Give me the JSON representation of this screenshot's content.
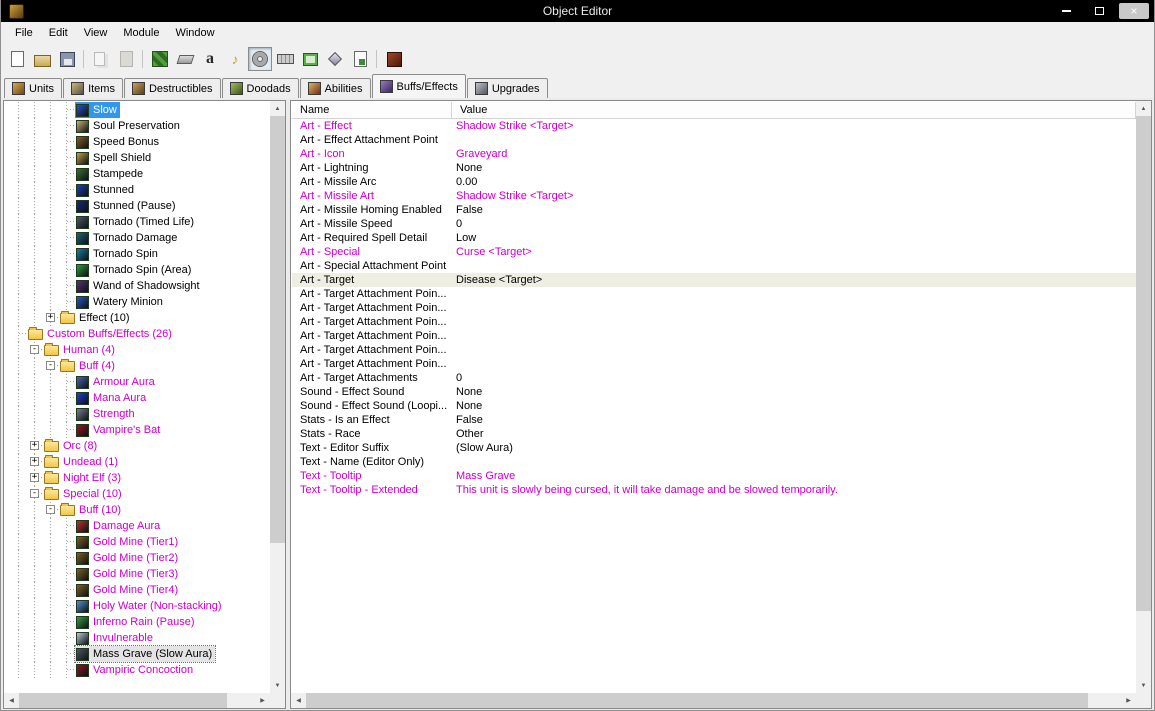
{
  "titlebar": {
    "title": "Object Editor"
  },
  "icons": {
    "close": "×",
    "scroll_up": "▲",
    "scroll_down": "▼",
    "scroll_left": "◀",
    "scroll_right": "▶",
    "expand": "+",
    "collapse": "-"
  },
  "colors": {
    "modified_text": "#c800c8",
    "selection_active": "#3296ef",
    "selection_inactive": "#e4e4e4",
    "titlebar_bg": "#000000"
  },
  "menubar": {
    "items": [
      "File",
      "Edit",
      "View",
      "Module",
      "Window"
    ]
  },
  "toolbar": {
    "buttons": [
      {
        "name": "new-map",
        "icon": "new-page"
      },
      {
        "name": "open-map",
        "icon": "open-folder"
      },
      {
        "name": "save-map",
        "icon": "save-floppy"
      },
      {
        "sep": true
      },
      {
        "name": "copy",
        "icon": "copy-pages",
        "disabled": true
      },
      {
        "name": "paste",
        "icon": "paste-clipboard",
        "disabled": true
      },
      {
        "sep": true
      },
      {
        "name": "terrain-editor",
        "icon": "terrain"
      },
      {
        "name": "eraser-tool",
        "icon": "eraser"
      },
      {
        "name": "trigger-editor",
        "icon": "letter-a",
        "glyph": "a"
      },
      {
        "name": "sound-editor",
        "icon": "speaker",
        "glyph": "♪"
      },
      {
        "name": "object-editor",
        "icon": "ring",
        "pressed": true
      },
      {
        "name": "campaign-editor",
        "icon": "keyboard"
      },
      {
        "name": "ai-editor",
        "icon": "ai-window"
      },
      {
        "name": "object-manager",
        "icon": "gem"
      },
      {
        "name": "import-manager",
        "icon": "import-page"
      },
      {
        "sep": true
      },
      {
        "name": "test-map",
        "icon": "test-map"
      }
    ]
  },
  "tabs": {
    "items": [
      {
        "label": "Units",
        "colors": [
          "#d8a850",
          "#6a4a18"
        ]
      },
      {
        "label": "Items",
        "colors": [
          "#c8b878",
          "#585048"
        ]
      },
      {
        "label": "Destructibles",
        "colors": [
          "#c8a060",
          "#584018"
        ]
      },
      {
        "label": "Doodads",
        "colors": [
          "#a8b860",
          "#3a5818"
        ]
      },
      {
        "label": "Abilities",
        "colors": [
          "#d8b860",
          "#7a2818"
        ]
      },
      {
        "label": "Buffs/Effects",
        "colors": [
          "#9878c8",
          "#382858"
        ],
        "active": true
      },
      {
        "label": "Upgrades",
        "colors": [
          "#c0c0c8",
          "#505860"
        ]
      }
    ]
  },
  "tree": {
    "items": [
      {
        "indent": 3,
        "label": "Slow",
        "icon": "#2a50c8",
        "custom": false,
        "selected": "active"
      },
      {
        "indent": 3,
        "label": "Soul Preservation",
        "icon": "#c8b070",
        "custom": false
      },
      {
        "indent": 3,
        "label": "Speed Bonus",
        "icon": "#8a5a28",
        "custom": false
      },
      {
        "indent": 3,
        "label": "Spell Shield",
        "icon": "#c0a040",
        "custom": false
      },
      {
        "indent": 3,
        "label": "Stampede",
        "icon": "#3a7030",
        "custom": false
      },
      {
        "indent": 3,
        "label": "Stunned",
        "icon": "#2040b0",
        "custom": false
      },
      {
        "indent": 3,
        "label": "Stunned (Pause)",
        "icon": "#182878",
        "custom": false
      },
      {
        "indent": 3,
        "label": "Tornado (Timed Life)",
        "icon": "#505868",
        "custom": false
      },
      {
        "indent": 3,
        "label": "Tornado Damage",
        "icon": "#186878",
        "custom": false
      },
      {
        "indent": 3,
        "label": "Tornado Spin",
        "icon": "#1880a8",
        "custom": false
      },
      {
        "indent": 3,
        "label": "Tornado Spin (Area)",
        "icon": "#28a038",
        "custom": false
      },
      {
        "indent": 3,
        "label": "Wand of Shadowsight",
        "icon": "#583078",
        "custom": false
      },
      {
        "indent": 3,
        "label": "Watery Minion",
        "icon": "#2858c8",
        "custom": false
      },
      {
        "indent": 2,
        "expander": "plus",
        "folder": true,
        "label": "Effect (10)",
        "custom": false
      },
      {
        "indent": 0,
        "folder": true,
        "label": "Custom Buffs/Effects (26)",
        "custom": true
      },
      {
        "indent": 1,
        "expander": "minus",
        "folder": true,
        "label": "Human (4)",
        "custom": true
      },
      {
        "indent": 2,
        "expander": "minus",
        "folder": true,
        "label": "Buff (4)",
        "custom": true
      },
      {
        "indent": 3,
        "label": "Armour Aura",
        "icon": "#4868b0",
        "custom": true
      },
      {
        "indent": 3,
        "label": "Mana Aura",
        "icon": "#2040d0",
        "custom": true
      },
      {
        "indent": 3,
        "label": "Strength",
        "icon": "#788090",
        "custom": true
      },
      {
        "indent": 3,
        "label": "Vampire's Bat",
        "icon": "#981820",
        "custom": true
      },
      {
        "indent": 1,
        "expander": "plus",
        "folder": true,
        "label": "Orc (8)",
        "custom": true
      },
      {
        "indent": 1,
        "expander": "plus",
        "folder": true,
        "label": "Undead (1)",
        "custom": true
      },
      {
        "indent": 1,
        "expander": "plus",
        "folder": true,
        "label": "Night Elf (3)",
        "custom": true
      },
      {
        "indent": 1,
        "expander": "minus",
        "folder": true,
        "label": "Special (10)",
        "custom": true
      },
      {
        "indent": 2,
        "expander": "minus",
        "folder": true,
        "label": "Buff (10)",
        "custom": true
      },
      {
        "indent": 3,
        "label": "Damage Aura",
        "icon": "#c03028",
        "custom": true
      },
      {
        "indent": 3,
        "label": "Gold Mine (Tier1)",
        "icon": "#806020",
        "custom": true
      },
      {
        "indent": 3,
        "label": "Gold Mine (Tier2)",
        "icon": "#806020",
        "custom": true
      },
      {
        "indent": 3,
        "label": "Gold Mine (Tier3)",
        "icon": "#806020",
        "custom": true
      },
      {
        "indent": 3,
        "label": "Gold Mine (Tier4)",
        "icon": "#806020",
        "custom": true
      },
      {
        "indent": 3,
        "label": "Holy Water (Non-stacking)",
        "icon": "#5090d0",
        "custom": true
      },
      {
        "indent": 3,
        "label": "Inferno Rain (Pause)",
        "icon": "#30a040",
        "custom": true
      },
      {
        "indent": 3,
        "label": "Invulnerable",
        "icon": "#b8c8d8",
        "custom": true
      },
      {
        "indent": 3,
        "label": "Mass Grave (Slow Aura)",
        "icon": "#505860",
        "custom": true,
        "selected": "inactive"
      },
      {
        "indent": 3,
        "label": "Vampiric Concoction",
        "icon": "#901820",
        "custom": true
      }
    ]
  },
  "grid": {
    "header": {
      "name": "Name",
      "value": "Value"
    },
    "rows": [
      {
        "name": "Art - Effect",
        "value": "Shadow Strike <Target>",
        "modified": true
      },
      {
        "name": "Art - Effect Attachment Point",
        "value": ""
      },
      {
        "name": "Art - Icon",
        "value": "Graveyard",
        "modified": true
      },
      {
        "name": "Art - Lightning",
        "value": "None"
      },
      {
        "name": "Art - Missile Arc",
        "value": "0.00"
      },
      {
        "name": "Art - Missile Art",
        "value": "Shadow Strike <Target>",
        "modified": true
      },
      {
        "name": "Art - Missile Homing Enabled",
        "value": "False"
      },
      {
        "name": "Art - Missile Speed",
        "value": "0"
      },
      {
        "name": "Art - Required Spell Detail",
        "value": "Low"
      },
      {
        "name": "Art - Special",
        "value": "Curse <Target>",
        "modified": true
      },
      {
        "name": "Art - Special Attachment Point",
        "value": ""
      },
      {
        "name": "Art - Target",
        "value": "Disease <Target>",
        "selected": true
      },
      {
        "name": "Art - Target Attachment Poin...",
        "value": ""
      },
      {
        "name": "Art - Target Attachment Poin...",
        "value": ""
      },
      {
        "name": "Art - Target Attachment Poin...",
        "value": ""
      },
      {
        "name": "Art - Target Attachment Poin...",
        "value": ""
      },
      {
        "name": "Art - Target Attachment Poin...",
        "value": ""
      },
      {
        "name": "Art - Target Attachment Poin...",
        "value": ""
      },
      {
        "name": "Art - Target Attachments",
        "value": "0"
      },
      {
        "name": "Sound - Effect Sound",
        "value": "None"
      },
      {
        "name": "Sound - Effect Sound (Loopi...",
        "value": "None"
      },
      {
        "name": "Stats - Is an Effect",
        "value": "False"
      },
      {
        "name": "Stats - Race",
        "value": "Other"
      },
      {
        "name": "Text - Editor Suffix",
        "value": "(Slow Aura)"
      },
      {
        "name": "Text - Name (Editor Only)",
        "value": ""
      },
      {
        "name": "Text - Tooltip",
        "value": "Mass Grave",
        "modified": true
      },
      {
        "name": "Text - Tooltip - Extended",
        "value": "This unit is slowly being cursed, it will take damage and be slowed temporarily.",
        "modified": true
      }
    ]
  }
}
